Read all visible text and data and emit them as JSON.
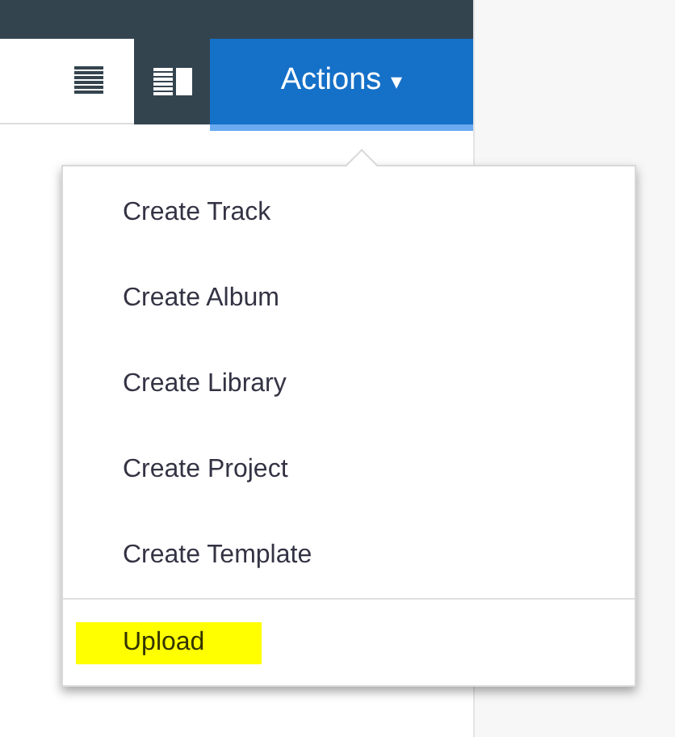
{
  "toolbar": {
    "views": [
      {
        "kind": "list",
        "selected": false
      },
      {
        "kind": "split",
        "selected": true
      }
    ],
    "actions_button": {
      "label": "Actions",
      "caret": "▾"
    }
  },
  "menu": {
    "items": [
      {
        "label": "Create Track",
        "highlighted": false
      },
      {
        "label": "Create Album",
        "highlighted": false
      },
      {
        "label": "Create Library",
        "highlighted": false
      },
      {
        "label": "Create Project",
        "highlighted": false
      },
      {
        "label": "Create Template",
        "highlighted": false
      }
    ],
    "footer_items": [
      {
        "label": "Upload",
        "highlighted": true
      }
    ]
  }
}
